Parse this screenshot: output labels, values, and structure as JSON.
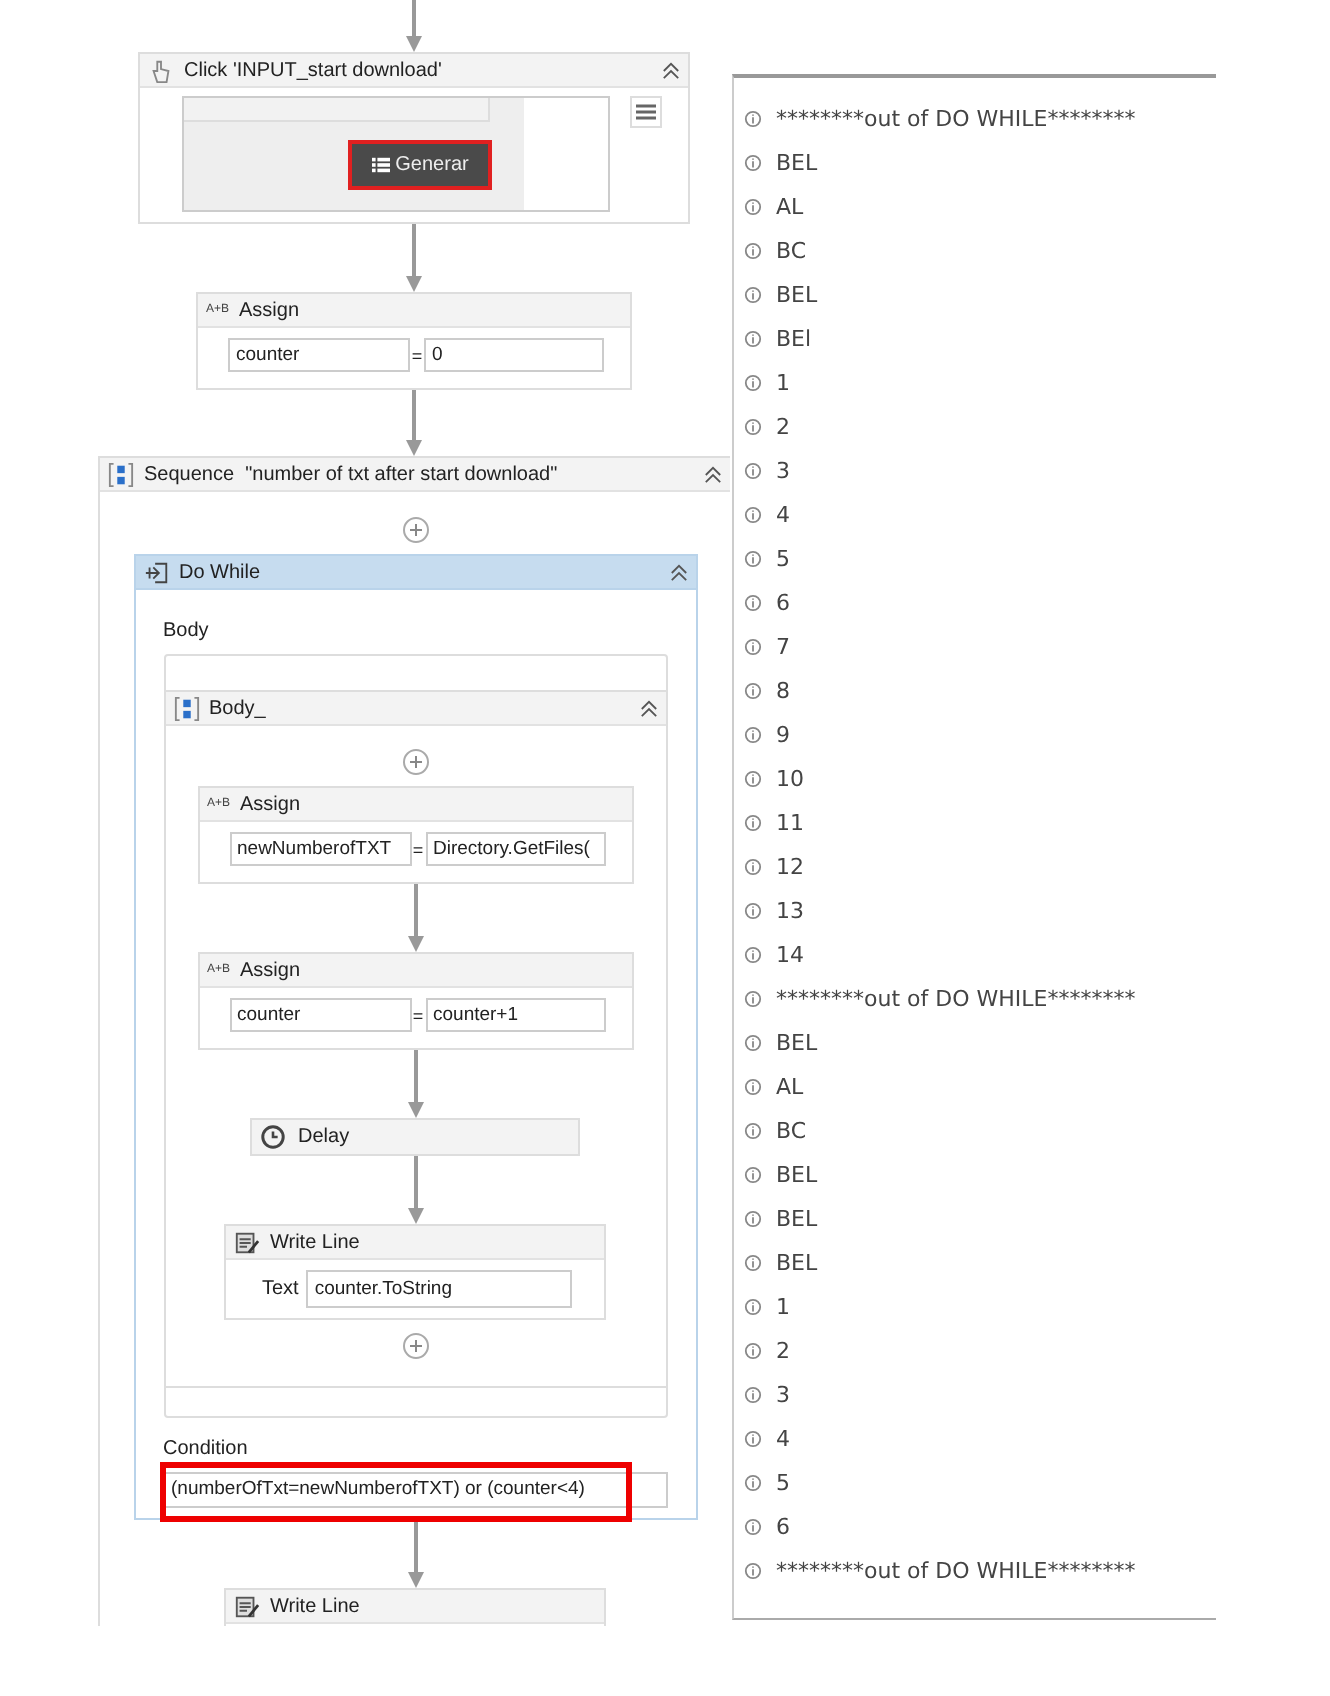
{
  "click_activity": {
    "title": "Click 'INPUT_start download'",
    "button": "Generar",
    "target_highlighted": true
  },
  "assign": {
    "icon_text": "A+B",
    "title": "Assign",
    "to": "counter",
    "operator": "=",
    "value": "0"
  },
  "sequence": {
    "title": "Sequence  \"number of txt after start download\"",
    "do_while": {
      "title": "Do While",
      "selected": true,
      "body_label": "Body",
      "body": {
        "title": "Body_",
        "activities": [
          {
            "kind": "assign",
            "icon_text": "A+B",
            "title": "Assign",
            "to": "newNumberofTXT",
            "operator": "=",
            "value": "Directory.GetFiles("
          },
          {
            "kind": "assign",
            "icon_text": "A+B",
            "title": "Assign",
            "to": "counter",
            "operator": "=",
            "value": "counter+1"
          },
          {
            "kind": "delay",
            "title": "Delay"
          },
          {
            "kind": "write_line",
            "title": "Write Line",
            "field_label": "Text",
            "value": "counter.ToString"
          }
        ]
      },
      "condition_label": "Condition",
      "condition": "(numberOfTxt=newNumberofTXT) or (counter<4)",
      "condition_highlighted": true
    },
    "after": {
      "title": "Write Line"
    }
  },
  "output": [
    "********out of DO WHILE********",
    "BEL",
    "AL",
    "BC",
    "BEL",
    "BEl",
    "1",
    "2",
    "3",
    "4",
    "5",
    "6",
    "7",
    "8",
    "9",
    "10",
    "11",
    "12",
    "13",
    "14",
    "********out of DO WHILE********",
    "BEL",
    "AL",
    "BC",
    "BEL",
    "BEL",
    "BEL",
    "1",
    "2",
    "3",
    "4",
    "5",
    "6",
    "********out of DO WHILE********"
  ]
}
